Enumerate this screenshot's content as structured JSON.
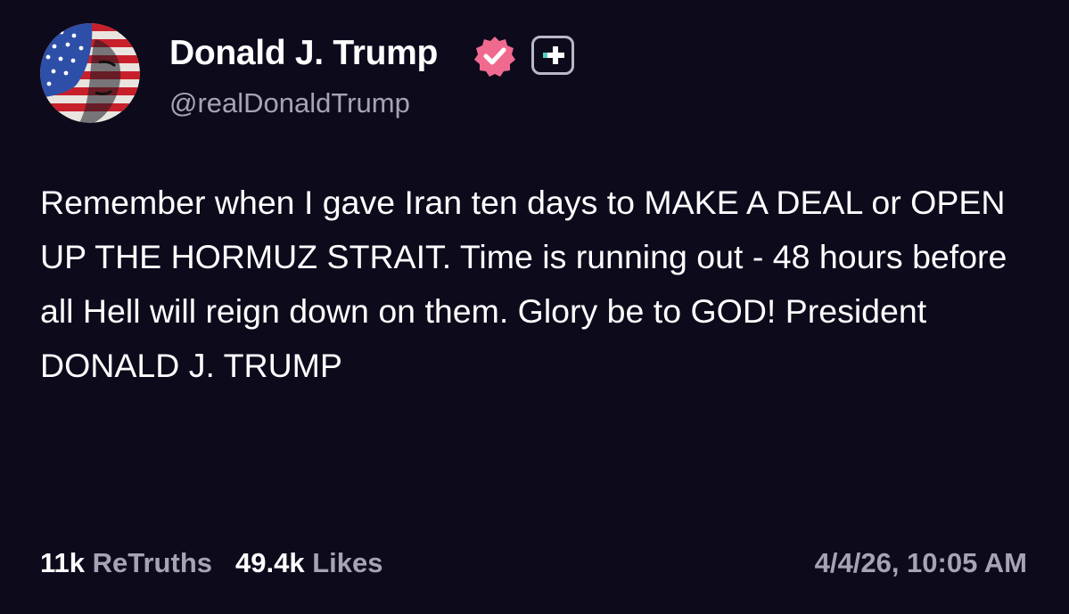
{
  "author": {
    "display_name": "Donald J. Trump",
    "handle": "@realDonaldTrump",
    "avatar_icon": "flag-painted-face-avatar",
    "verified_icon": "verified-badge-icon",
    "plus_icon": "plus-badge-icon"
  },
  "post": {
    "text": "Remember when I gave Iran ten days to MAKE A DEAL or OPEN UP THE HORMUZ STRAIT. Time is running out - 48 hours before all Hell will reign down on them. Glory be to GOD! President DONALD J. TRUMP"
  },
  "stats": {
    "retruths_count": "11k",
    "retruths_label": "ReTruths",
    "likes_count": "49.4k",
    "likes_label": "Likes"
  },
  "timestamp": "4/4/26, 10:05 AM",
  "colors": {
    "background": "#0d0a1c",
    "text_primary": "#ffffff",
    "text_secondary": "#a5a4b4",
    "verified_badge": "#f06a8f",
    "plus_badge_accent": "#4fd1c5"
  }
}
